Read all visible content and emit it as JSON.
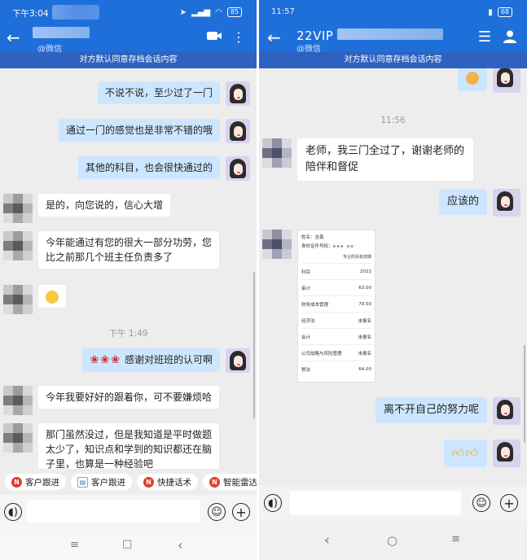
{
  "left": {
    "status": {
      "time": "下午3:04",
      "battery": "85"
    },
    "header": {
      "subtitle": "@微信"
    },
    "notice": "对方默认同意存档会话内容",
    "messages": [
      {
        "side": "me",
        "text": "不说不说，至少过了一门"
      },
      {
        "side": "me",
        "text": "通过一门的感觉也是非常不错的哦"
      },
      {
        "side": "me",
        "text": "其他的科目，也会很快通过的"
      },
      {
        "side": "them",
        "text": "是的，向您说的，信心大增"
      },
      {
        "side": "them",
        "text": "今年能通过有您的很大一部分功劳，您比之前那几个班主任负责多了"
      },
      {
        "side": "them",
        "emoji": "smiley"
      },
      {
        "side": "me",
        "text": "感谢对班班的认可啊"
      },
      {
        "side": "them",
        "text": "今年我要好好的跟着你，可不要嫌烦哈"
      },
      {
        "side": "them",
        "text": "那门虽然没过，但是我知道是平时做题太少了，知识点和学到的知识都还在脑子里，也算是一种经验吧"
      }
    ],
    "timestamp": "下午 1:49",
    "chips": [
      {
        "label": "客户跟进",
        "icon": "n-logo-icon"
      },
      {
        "label": "客户跟进",
        "icon": "document-icon"
      },
      {
        "label": "快捷话术",
        "icon": "n-logo-icon"
      },
      {
        "label": "智能雷达",
        "icon": "n-logo-icon"
      }
    ],
    "nav": {
      "menu": "≡",
      "home": "□",
      "back": "‹"
    }
  },
  "right": {
    "status": {
      "time": "11:57",
      "battery": "68"
    },
    "header": {
      "title": "22VIP",
      "subtitle": "@微信"
    },
    "notice": "对方默认同意存档会话内容",
    "timestamp": "11:56",
    "messages": [
      {
        "side": "them",
        "text": "老师，我三门全过了，谢谢老师的陪伴和督促"
      },
      {
        "side": "me",
        "text": "应该的"
      },
      {
        "side": "them",
        "type": "image",
        "caption": "certificate"
      },
      {
        "side": "me",
        "text": "离不开自己的努力呢"
      },
      {
        "side": "me",
        "emoji": "thumbs-up"
      }
    ],
    "certificate": {
      "name_label": "姓名：",
      "name_value": "吉鑫",
      "id_label": "身份证件号码：",
      "section": "专业阶段有效期",
      "rows": [
        {
          "subject": "科目",
          "value": "2022"
        },
        {
          "subject": "审计",
          "value": "63.00"
        },
        {
          "subject": "财务成本管理",
          "value": "79.50"
        },
        {
          "subject": "经济法",
          "value": "未报名"
        },
        {
          "subject": "会计",
          "value": "未报名"
        },
        {
          "subject": "公司战略与风险管理",
          "value": "未报名"
        },
        {
          "subject": "税法",
          "value": "64.00"
        }
      ]
    },
    "nav": {
      "back": "‹",
      "home": "○",
      "menu": "≡"
    }
  },
  "colors": {
    "header_blue": "#1e6fd9",
    "notice_blue": "#2d62c0",
    "my_bubble": "#cde6ff",
    "their_bubble": "#ffffff",
    "chat_bg": "#ededed"
  }
}
